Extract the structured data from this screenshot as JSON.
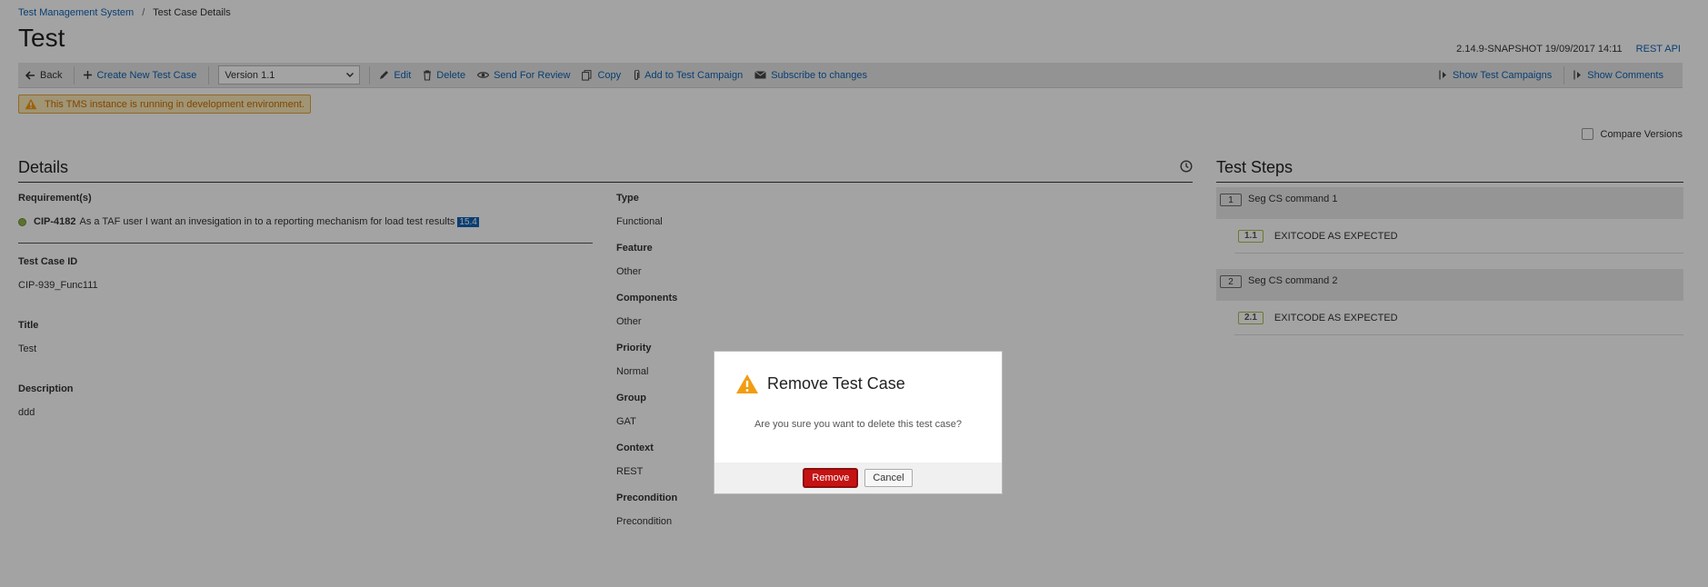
{
  "breadcrumb": {
    "root": "Test Management System",
    "separator": "/",
    "current": "Test Case Details"
  },
  "page_title": "Test",
  "version_info": {
    "build": "2.14.9-SNAPSHOT 19/09/2017 14:11",
    "rest_api": "REST API"
  },
  "toolbar": {
    "back": "Back",
    "create_new": "Create New Test Case",
    "version_select": "Version 1.1",
    "edit": "Edit",
    "delete": "Delete",
    "send_for_review": "Send For Review",
    "copy": "Copy",
    "add_to_campaign": "Add to Test Campaign",
    "subscribe": "Subscribe to changes",
    "show_campaigns": "Show Test Campaigns",
    "show_comments": "Show Comments"
  },
  "env_warning": "This TMS instance is running in development environment.",
  "compare_versions": "Compare Versions",
  "details": {
    "header": "Details",
    "requirements_label": "Requirement(s)",
    "requirement": {
      "id": "CIP-4182",
      "text": "As a TAF user I want an invesigation in to a reporting mechanism for load test results",
      "tag": "15.4"
    },
    "test_case_id_label": "Test Case ID",
    "test_case_id": "CIP-939_Func111",
    "title_label": "Title",
    "title": "Test",
    "description_label": "Description",
    "description": "ddd",
    "type_label": "Type",
    "type": "Functional",
    "feature_label": "Feature",
    "feature": "Other",
    "components_label": "Components",
    "components": "Other",
    "priority_label": "Priority",
    "priority": "Normal",
    "group_label": "Group",
    "group": "GAT",
    "context_label": "Context",
    "context": "REST",
    "precondition_label": "Precondition",
    "precondition": "Precondition"
  },
  "test_steps": {
    "header": "Test Steps",
    "steps": [
      {
        "num": "1",
        "title": "Seg CS command 1",
        "sub_num": "1.1",
        "sub_text": "EXITCODE AS EXPECTED"
      },
      {
        "num": "2",
        "title": "Seg CS command 2",
        "sub_num": "2.1",
        "sub_text": "EXITCODE AS EXPECTED"
      }
    ]
  },
  "modal": {
    "title": "Remove Test Case",
    "message": "Are you sure you want to delete this test case?",
    "remove": "Remove",
    "cancel": "Cancel"
  },
  "colors": {
    "link": "#0e63b4",
    "remove_button": "#c41313",
    "warning_bg": "#fbe9b8",
    "warning_text": "#c86e00",
    "warning_icon": "#f29c11"
  }
}
